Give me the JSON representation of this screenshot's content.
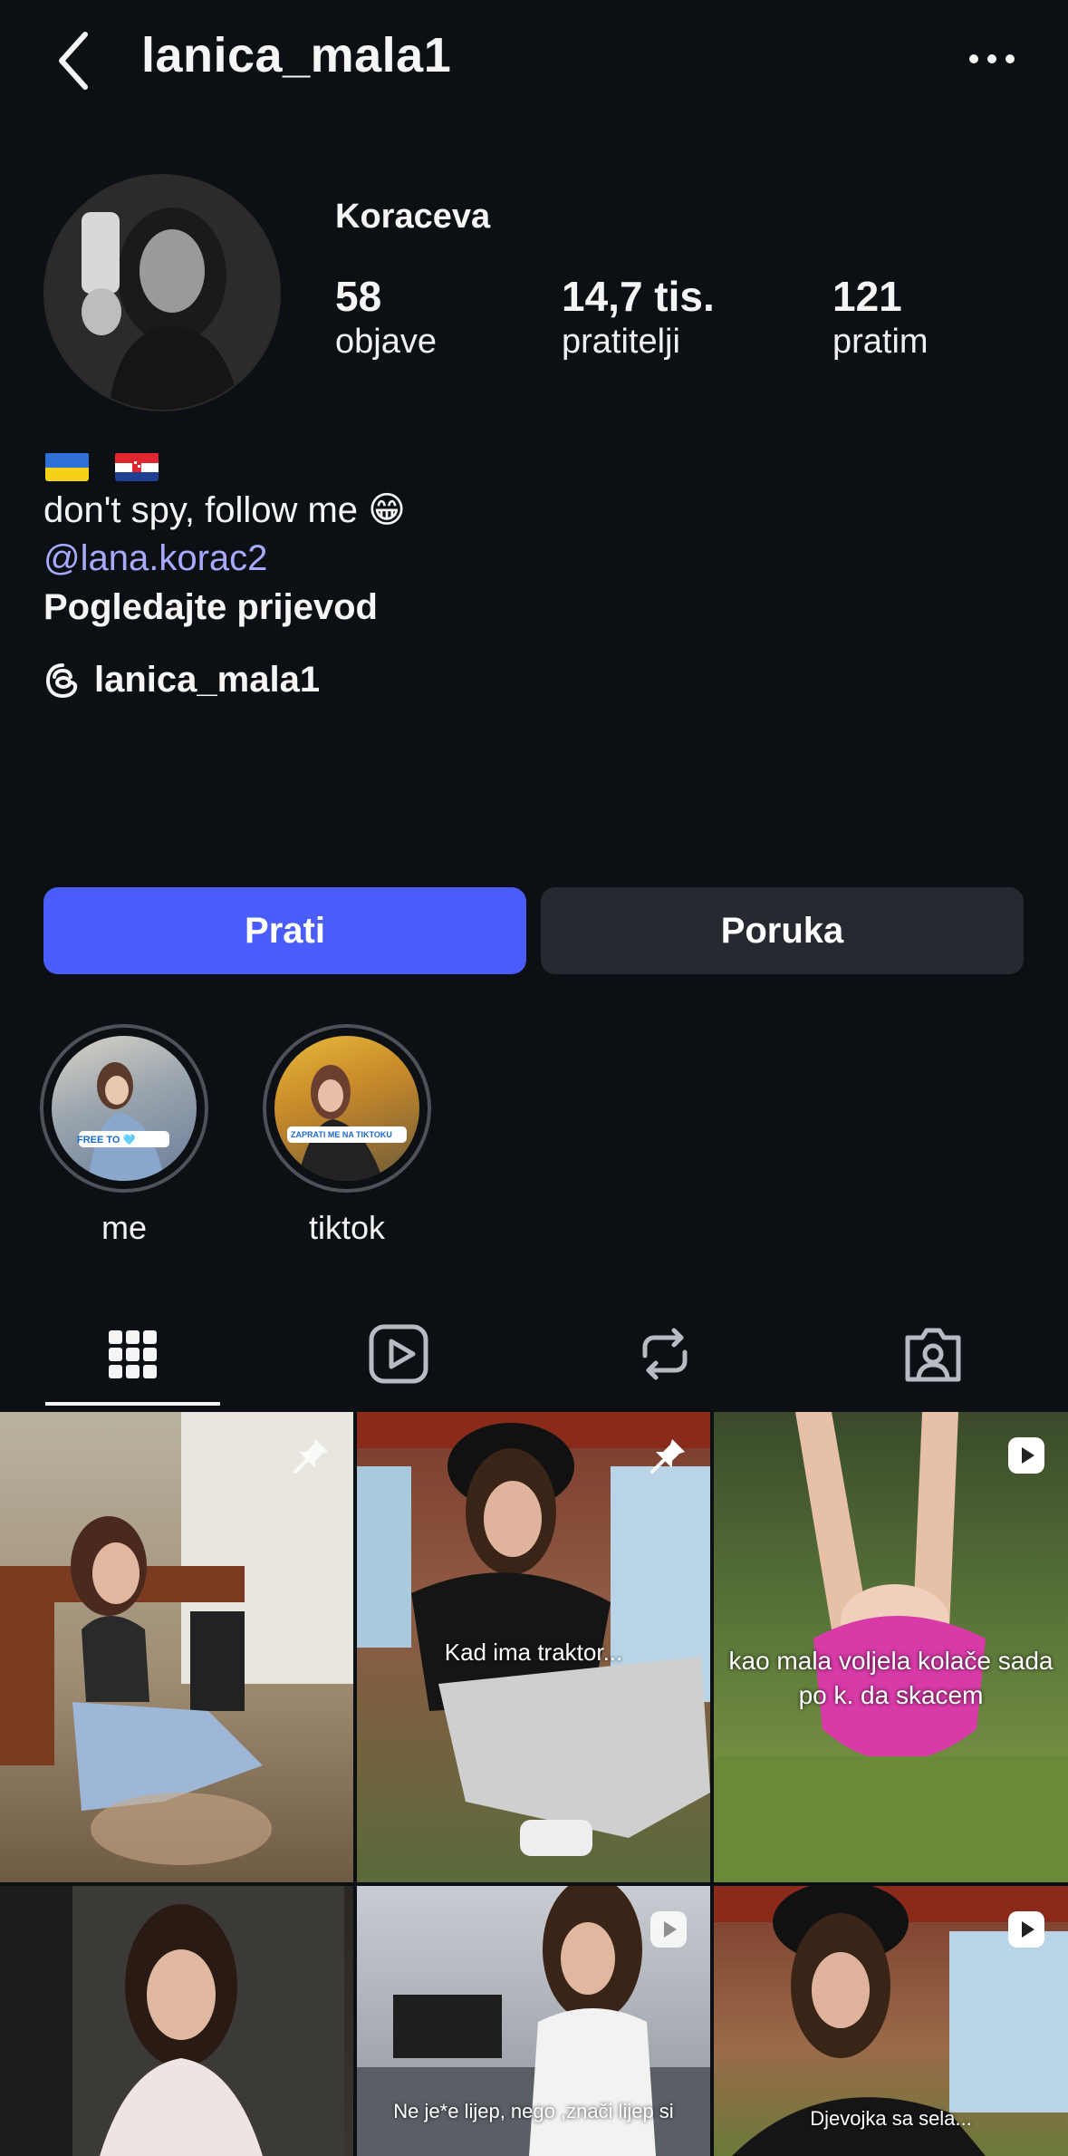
{
  "header": {
    "username": "lanica_mala1"
  },
  "profile": {
    "display_name": "Koraceva",
    "stats": [
      {
        "value": "58",
        "label": "objave"
      },
      {
        "value": "14,7 tis.",
        "label": "pratitelji"
      },
      {
        "value": "121",
        "label": "pratim"
      }
    ],
    "bio": {
      "text": "don't spy, follow me 😁",
      "mention": "@lana.korac2",
      "translate": "Pogledajte prijevod",
      "threads_handle": "lanica_mala1"
    }
  },
  "buttons": {
    "follow": "Prati",
    "message": "Poruka"
  },
  "highlights": [
    {
      "label": "me",
      "sticker": "FREE TO 🩵"
    },
    {
      "label": "tiktok",
      "sticker": "ZAPRATI ME NA TIKTOKU"
    }
  ],
  "tabs": [
    "grid-icon",
    "reels-icon",
    "reposts-icon",
    "tagged-icon"
  ],
  "posts": [
    {
      "caption": "",
      "badge": "pin-icon"
    },
    {
      "caption": "Kad ima traktor...",
      "badge": "pin-icon"
    },
    {
      "caption": "kao mala voljela kolače sada po k. da skacem",
      "badge": "reel-icon"
    },
    {
      "caption": "",
      "badge": ""
    },
    {
      "caption": "Ne je*e lijep, nego ,znači lijep si",
      "badge": "reel-icon"
    },
    {
      "caption": "Djevojka sa sela...",
      "badge": "reel-icon"
    }
  ],
  "colors": {
    "background": "#0c1014",
    "accent": "#4a5dfa",
    "link": "#a8aaff",
    "secondary_button": "#262a30"
  }
}
